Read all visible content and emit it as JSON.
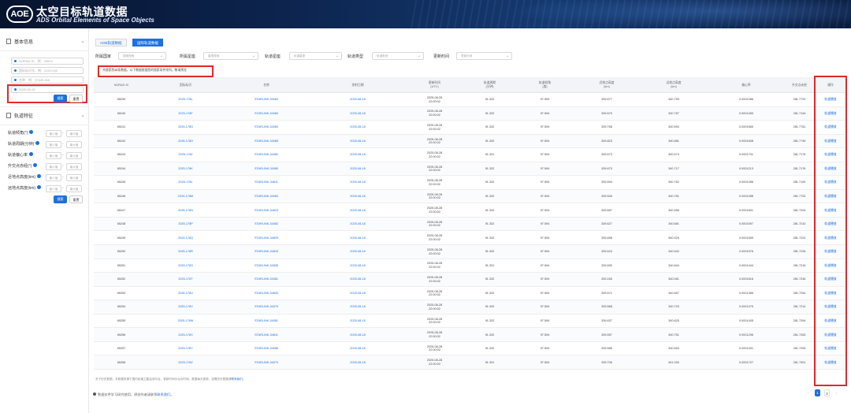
{
  "header": {
    "logo": "AOE",
    "title": "太空目标轨道数据",
    "subtitle": "ADS Orbital Elements of Space Objects"
  },
  "sidebar": {
    "basic_section": "基本信息",
    "inputs": [
      {
        "placeholder": "NORAD ID、例：25544"
      },
      {
        "placeholder": "国际标识号、例：2020-040"
      },
      {
        "placeholder": "名称、例：STARLINK"
      },
      {
        "placeholder": "2025-05-19"
      }
    ],
    "search_label": "搜索",
    "reset_label": "重置",
    "orbit_section": "轨道特征",
    "filters": [
      {
        "label": "轨道倾角(°)"
      },
      {
        "label": "轨道周期(分钟)"
      },
      {
        "label": "轨道偏心率"
      },
      {
        "label": "升交点赤经(°)"
      },
      {
        "label": "近地点高度(km)"
      },
      {
        "label": "远地点高度(km)"
      }
    ],
    "min_placeholder": "最小值",
    "max_placeholder": "最大值",
    "dash": "-",
    "search2_label": "搜索",
    "reset2_label": "重置"
  },
  "tabs": [
    {
      "label": "AOE轨道数据"
    },
    {
      "label": "国际轨道数据"
    }
  ],
  "filters": [
    {
      "label": "所属国家",
      "placeholder": "国家搜索"
    },
    {
      "label": "所属星座",
      "placeholder": "星座搜索"
    },
    {
      "label": "轨道星座",
      "placeholder": "轨道星座"
    },
    {
      "label": "轨道类型",
      "placeholder": "轨道类型"
    },
    {
      "label": "更新时间",
      "placeholder": "更新时间"
    }
  ],
  "notice": {
    "prefix": "共搜索到",
    "count": "26",
    "suffix": "条数据，以下数据根据您的搜索条件排列。敬请预览"
  },
  "table": {
    "columns": [
      "NORAD ID",
      "国际标识",
      "名称",
      "发射日期",
      "更新时间\n(UTC)",
      "轨道周期\n(分钟)",
      "轨道倾角\n(度)",
      "近地点高度\n(km)",
      "远地点高度\n(km)",
      "偏心率",
      "升交点赤经",
      "操作"
    ],
    "action_label": "轨道播放",
    "rows": [
      [
        "65239",
        "2025-178L",
        "STARLINK-34064",
        "2025-08-18",
        "2025-08-28\n22:00:02",
        "91.332",
        "97.594",
        "339.677",
        "340.759",
        "0.0001286",
        "281.7722"
      ],
      [
        "65240",
        "2025-178F",
        "STARLINK-34083",
        "2025-08-18",
        "2025-08-28\n22:00:02",
        "91.332",
        "97.594",
        "339.679",
        "340.767",
        "0.0001283",
        "281.7144"
      ],
      [
        "65241",
        "2025-178G",
        "STARLINK-34084",
        "2025-08-18",
        "2025-08-28\n22:00:02",
        "91.332",
        "97.594",
        "339.768",
        "340.594",
        "0.0001665",
        "281.7761"
      ],
      [
        "65242",
        "2025-178H",
        "STARLINK-34085",
        "2025-08-18",
        "2025-08-28\n22:00:02",
        "91.332",
        "97.594",
        "339.823",
        "340.681",
        "0.0001608",
        "281.7749"
      ],
      [
        "65243",
        "2025-178J",
        "STARLINK-34082",
        "2025-08-18",
        "2025-08-28\n22:00:02",
        "91.331",
        "97.594",
        "339.673",
        "340.674",
        "0.0001701",
        "281.7175"
      ],
      [
        "65244",
        "2025-178K",
        "STARLINK-34080",
        "2025-08-18",
        "2025-08-28\n22:00:02",
        "91.332",
        "97.594",
        "339.673",
        "340.717",
        "0.0001213",
        "281.7176"
      ],
      [
        "65245",
        "2025-178L",
        "STARLINK-34811",
        "2025-08-18",
        "2025-08-28\n22:00:02",
        "91.332",
        "97.594",
        "339.594",
        "340.762",
        "0.0001286",
        "281.7190"
      ],
      [
        "65246",
        "2025-178M",
        "STARLINK-34063",
        "2025-08-18",
        "2025-08-28\n22:00:02",
        "91.332",
        "97.594",
        "339.545",
        "340.751",
        "0.0001285",
        "281.7702"
      ],
      [
        "65247",
        "2025-178N",
        "STARLINK-34823",
        "2025-08-18",
        "2025-08-28\n22:00:02",
        "91.332",
        "97.594",
        "339.657",
        "340.556",
        "0.0001601",
        "281.7204"
      ],
      [
        "65248",
        "2025-178P",
        "STARLINK-34082",
        "2025-08-18",
        "2025-08-28\n22:00:02",
        "91.332",
        "97.594",
        "339.627",
        "340.681",
        "0.0001597",
        "281.7210"
      ],
      [
        "65249",
        "2025-178Q",
        "STARLINK-34829",
        "2025-08-18",
        "2025-08-28\n22:00:02",
        "91.332",
        "97.594",
        "339.658",
        "340.529",
        "0.0001559",
        "281.7220"
      ],
      [
        "65250",
        "2025-178R",
        "STARLINK-34815",
        "2025-08-18",
        "2025-08-28\n22:00:02",
        "91.332",
        "97.594",
        "339.624",
        "340.542",
        "0.0001576",
        "281.7226"
      ],
      [
        "65251",
        "2025-178S",
        "STARLINK-34835",
        "2025-08-18",
        "2025-08-28\n22:00:02",
        "91.331",
        "97.594",
        "339.690",
        "340.644",
        "0.0001444",
        "281.7216"
      ],
      [
        "65252",
        "2025-178T",
        "STARLINK-34081",
        "2025-08-18",
        "2025-08-28\n22:00:02",
        "91.332",
        "97.594",
        "339.165",
        "340.061",
        "0.0001616",
        "281.7245"
      ],
      [
        "65253",
        "2025-178U",
        "STARLINK-34833",
        "2025-08-18",
        "2025-08-28\n22:00:02",
        "91.332",
        "97.594",
        "339.671",
        "340.657",
        "0.0001385",
        "281.7254"
      ],
      [
        "65254",
        "2025-178V",
        "STARLINK-34079",
        "2025-08-18",
        "2025-08-28\n22:00:02",
        "91.332",
        "97.594",
        "339.568",
        "340.723",
        "0.0001375",
        "281.7214"
      ],
      [
        "65255",
        "2025-178W",
        "STARLINK-34081",
        "2025-08-18",
        "2025-08-28\n22:00:02",
        "91.332",
        "97.594",
        "339.637",
        "340.625",
        "0.0001405",
        "281.7264"
      ],
      [
        "65256",
        "2025-178X",
        "STARLINK-34811",
        "2025-08-18",
        "2025-08-28\n22:00:02",
        "91.332",
        "97.594",
        "339.557",
        "340.751",
        "0.0001296",
        "281.7263"
      ],
      [
        "65257",
        "2025-178Y",
        "STARLINK-34086",
        "2025-08-18",
        "2025-08-28\n22:00:02",
        "91.332",
        "97.594",
        "339.585",
        "340.653",
        "0.0001401",
        "281.7253"
      ],
      [
        "65258",
        "2025-178Z",
        "STARLINK-34079",
        "2025-08-18",
        "2025-08-28\n22:00:02",
        "91.331",
        "97.594",
        "339.706",
        "341.030",
        "0.0001727",
        "281.7301"
      ]
    ]
  },
  "footnote": {
    "text": "关于历史数据，本数据来源于国内权威卫星监测平台。更新时间为北京时间。数据每天更新，如需历史数据请",
    "link": "联系我们。"
  },
  "bottom": {
    "text": "数据仅供学习研究使用，原创作者请联系",
    "link": "联系我们。"
  },
  "pager": {
    "prev": "‹",
    "pages": [
      "1",
      "2"
    ],
    "next": "›"
  }
}
